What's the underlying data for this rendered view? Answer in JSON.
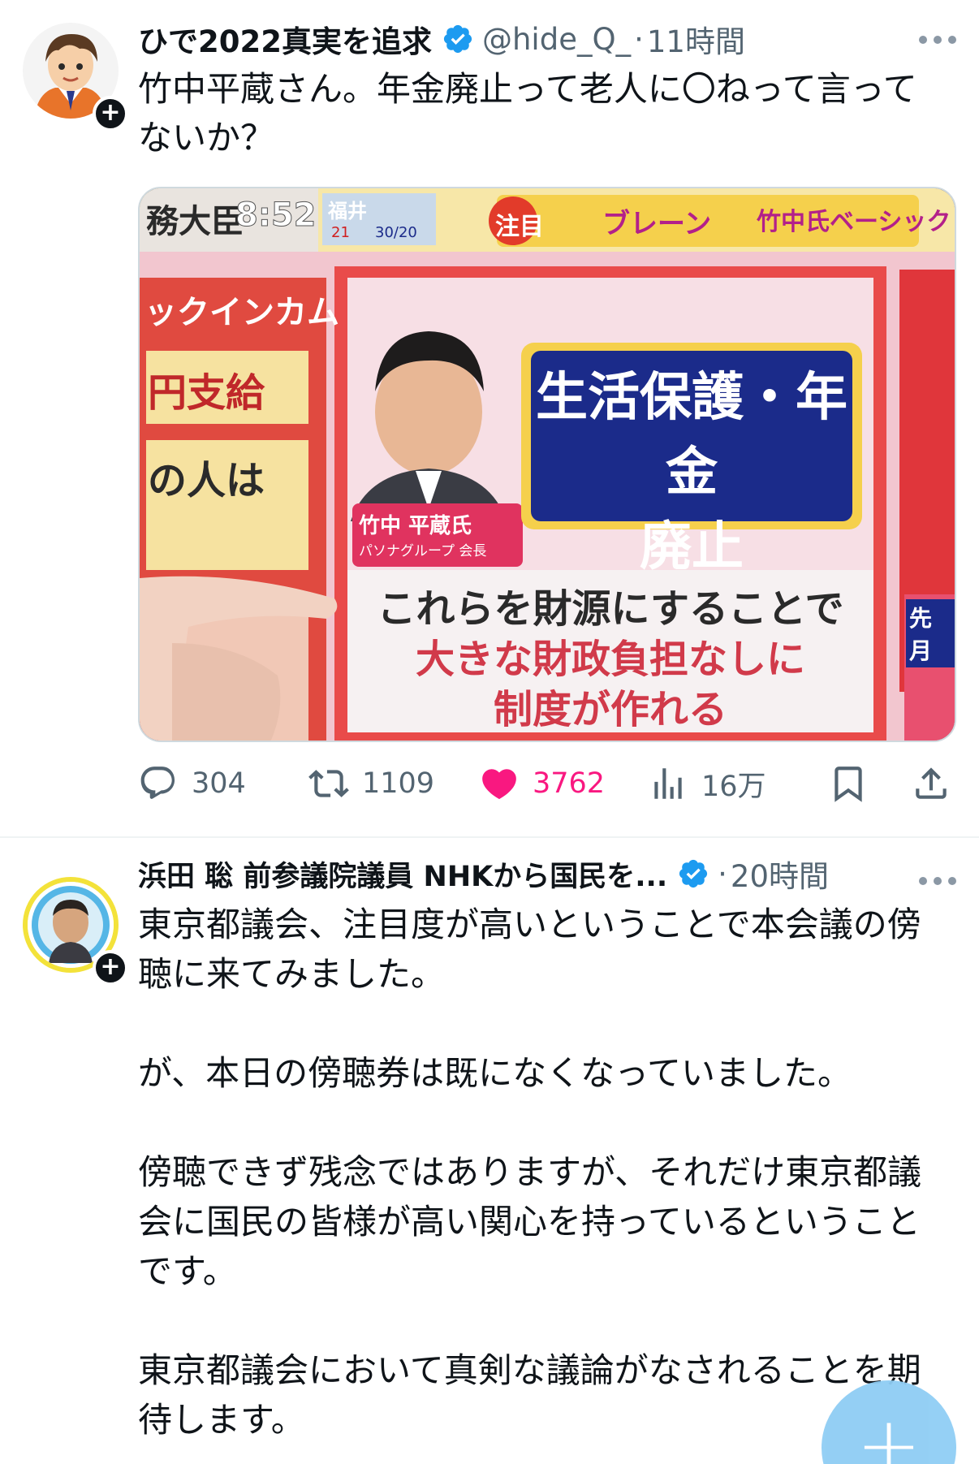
{
  "tweets": [
    {
      "author_name": "ひで2022真実を追求",
      "handle": "@hide_Q_",
      "separator": "·",
      "time": "11時間",
      "text": "竹中平蔵さん。年金廃止って老人に〇ねって言ってないか？",
      "media": {
        "top_bar_left": "務大臣",
        "top_bar_num": "8:52",
        "weather_city": "福井",
        "weather_temp": "21",
        "weather_range": "30/20",
        "ticker_tag": "注目",
        "ticker_text": "ブレーン",
        "ticker_text2": "竹中氏ベーシック",
        "left_panel_1": "ックインカム",
        "left_panel_2": "円支給",
        "left_panel_3": "の人は",
        "person_name": "竹中 平蔵氏",
        "person_title": "パソナグループ 会長",
        "headline": "生活保護・年金\n廃止",
        "caption_1": "これらを財源にすることで",
        "caption_2": "大きな財政負担なしに",
        "caption_3": "制度が作れる",
        "side_label": "先月"
      },
      "stats": {
        "replies": "304",
        "retweets": "1109",
        "likes": "3762",
        "views": "16万"
      }
    },
    {
      "author_name": "浜田 聡 前参議院議員 NHKから国民を...",
      "separator": "·",
      "time": "20時間",
      "text": "東京都議会、注目度が高いということで本会議の傍聴に来てみました。\n\nが、本日の傍聴券は既になくなっていました。\n\n傍聴できず残念ではありますが、それだけ東京都議会に国民の皆様が高い関心を持っているということです。\n\n東京都議会において真剣な議論がなされることを期待します。"
    }
  ],
  "fab": {
    "label": "+"
  },
  "colors": {
    "verified": "#1d9bf0",
    "like": "#f91880",
    "secondary_text": "#536471",
    "fab": "#8fcdf4"
  },
  "icons": [
    "reply-icon",
    "retweet-icon",
    "heart-icon",
    "views-icon",
    "bookmark-icon",
    "share-icon",
    "verified-badge-icon",
    "more-icon"
  ]
}
